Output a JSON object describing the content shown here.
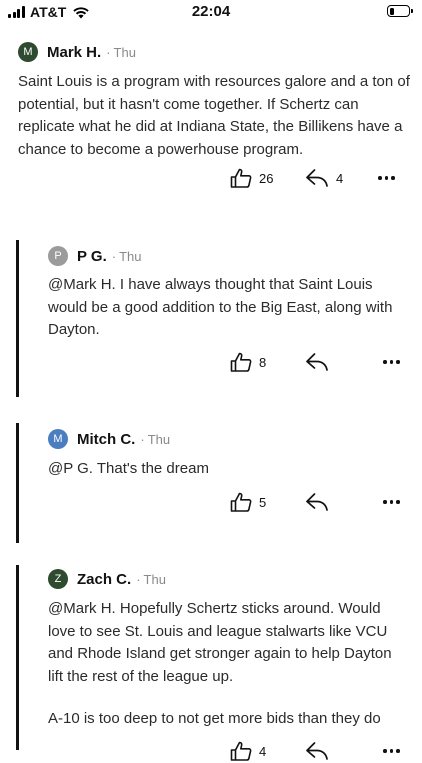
{
  "status_bar": {
    "carrier": "AT&T",
    "time": "22:04",
    "battery_level": 0.25
  },
  "comments": [
    {
      "author": "Mark H.",
      "initial": "M",
      "avatar_color": "#2e4a2f",
      "separator": "·",
      "time": "Thu",
      "paragraphs": [
        "Saint Louis is a program with resources galore and a ton of potential, but it hasn't come together. If Schertz can replicate what he did at Indiana State, the Billikens have a chance to become a powerhouse program."
      ],
      "likes": "26",
      "replies": "4"
    },
    {
      "author": "P G.",
      "initial": "P",
      "avatar_color": "#9b9b9b",
      "separator": "·",
      "time": "Thu",
      "paragraphs": [
        "@Mark H. I have always thought that Saint Louis would be a good addition to the Big East, along with Dayton."
      ],
      "likes": "8",
      "replies": ""
    },
    {
      "author": "Mitch C.",
      "initial": "M",
      "avatar_color": "#4a7ec0",
      "separator": "·",
      "time": "Thu",
      "paragraphs": [
        "@P G. That's the dream"
      ],
      "likes": "5",
      "replies": ""
    },
    {
      "author": "Zach C.",
      "initial": "Z",
      "avatar_color": "#2e4a2f",
      "separator": "·",
      "time": "Thu",
      "paragraphs": [
        "@Mark H. Hopefully Schertz sticks around. Would love to see St. Louis and league stalwarts like VCU and Rhode Island get stronger again to help Dayton lift the rest of the league up.",
        "A-10 is too deep to not get more bids than they do"
      ],
      "likes": "4",
      "replies": ""
    }
  ],
  "icons": {
    "like": "thumbs-up-icon",
    "reply": "reply-arrow-icon",
    "more": "more-options-icon"
  }
}
